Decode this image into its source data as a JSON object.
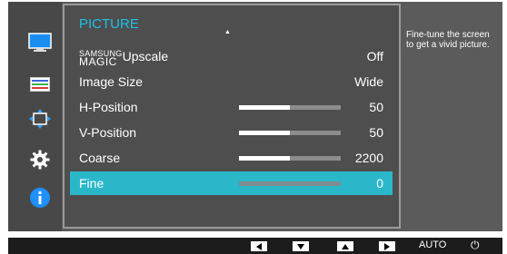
{
  "menu": {
    "title": "PICTURE",
    "scroll_up_glyph": "▲",
    "items": [
      {
        "brand": "SAMSUNG",
        "brand_sub": "MAGIC",
        "label": "Upscale",
        "value": "Off"
      },
      {
        "label": "Image Size",
        "value": "Wide"
      },
      {
        "label": "H-Position",
        "value": "50",
        "level": 0.5
      },
      {
        "label": "V-Position",
        "value": "50",
        "level": 0.5
      },
      {
        "label": "Coarse",
        "value": "2200",
        "level": 0.5
      },
      {
        "label": "Fine",
        "value": "0",
        "level": 0,
        "selected": true
      }
    ]
  },
  "info": {
    "text": "Fine-tune the screen to get a vivid picture."
  },
  "left_icons": [
    "monitor-picture-icon",
    "color-bars-icon",
    "resize-arrows-icon",
    "gear-icon",
    "info-icon"
  ],
  "bottom": {
    "buttons": [
      "left-arrow",
      "down-arrow",
      "up-arrow",
      "right-arrow"
    ],
    "auto_label": "AUTO",
    "power_glyph": "⏻"
  },
  "colors": {
    "accent": "#1fc0e6",
    "selection": "#2ab7ca",
    "panel": "#4e4e4e",
    "info_icon": "#1e90ff"
  }
}
